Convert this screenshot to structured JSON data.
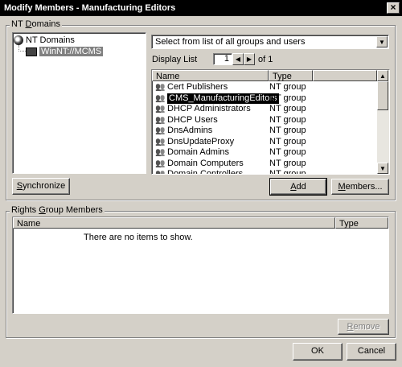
{
  "window": {
    "title": "Modify Members - Manufacturing Editors",
    "close_glyph": "×"
  },
  "nt_domains": {
    "label_prefix": "NT ",
    "label_underlined": "D",
    "label_suffix": "omains",
    "tree_root": "NT Domains",
    "tree_child": "WinNT://MCMS"
  },
  "combo": {
    "value": "Select from list of all groups and users"
  },
  "display_list": {
    "label": "Display List",
    "page": "1",
    "of_label": "of 1"
  },
  "list": {
    "col_name": "Name",
    "col_type": "Type",
    "rows": [
      {
        "name": "Cert Publishers",
        "type": "NT group"
      },
      {
        "name": "CMS_ManufacturingEditors",
        "type": "NT group"
      },
      {
        "name": "DHCP Administrators",
        "type": "NT group"
      },
      {
        "name": "DHCP Users",
        "type": "NT group"
      },
      {
        "name": "DnsAdmins",
        "type": "NT group"
      },
      {
        "name": "DnsUpdateProxy",
        "type": "NT group"
      },
      {
        "name": "Domain Admins",
        "type": "NT group"
      },
      {
        "name": "Domain Computers",
        "type": "NT group"
      },
      {
        "name": "Domain Controllers",
        "type": "NT group"
      }
    ],
    "selected_index": 1
  },
  "buttons": {
    "synchronize_u": "S",
    "synchronize_rest": "ynchronize",
    "add_u": "A",
    "add_rest": "dd",
    "members_u": "M",
    "members_rest": "embers...",
    "remove_u": "R",
    "remove_rest": "emove",
    "ok": "OK",
    "cancel": "Cancel"
  },
  "rights_group": {
    "label_pre": "Rights ",
    "label_u": "G",
    "label_post": "roup Members",
    "col_name": "Name",
    "col_type": "Type",
    "empty_text": "There are no items to show."
  }
}
